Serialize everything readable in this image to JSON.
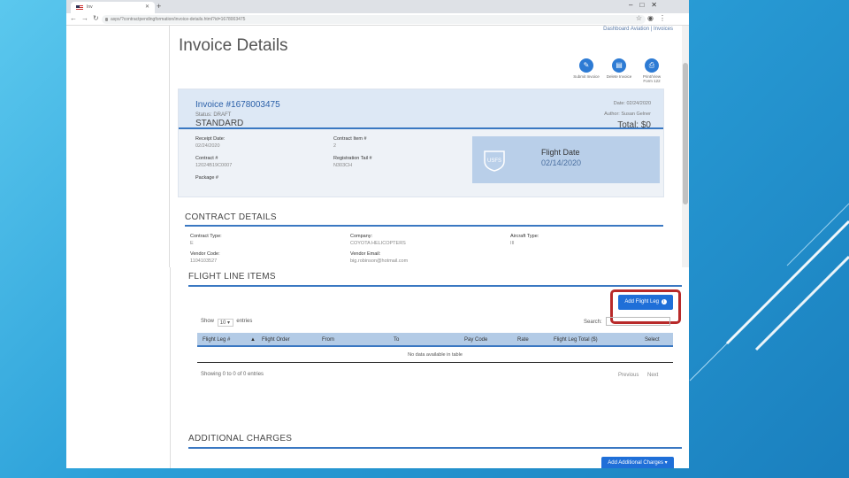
{
  "colors": {
    "accent": "#3a78c2",
    "button": "#1f6fd8",
    "highlight_box": "#b82a2a",
    "slide_bg": "#2a9fd8"
  },
  "browser": {
    "tab_title": "Inv",
    "address": "aspx/?contractpendingformation/invoice-details.html?id=1678003475",
    "icons": [
      "back-icon",
      "forward-icon",
      "reload-icon",
      "star-icon",
      "account-icon",
      "menu-icon"
    ]
  },
  "header": {
    "links": "Dashboard   Aviation   |   Invoices",
    "title": "Invoice Details",
    "actions": [
      {
        "label": "Submit Invoice",
        "icon": "edit-icon",
        "glyph": "✎"
      },
      {
        "label": "Delete Invoice",
        "icon": "document-icon",
        "glyph": "▤"
      },
      {
        "label": "Print/View Form 122",
        "icon": "print-icon",
        "glyph": "⎙"
      }
    ]
  },
  "invoice": {
    "number": "Invoice #1678003475",
    "status": "Status: DRAFT",
    "type": "STANDARD",
    "date": "Date: 02/24/2020",
    "author": "Author: Susan Gelner",
    "total": "Total: $0",
    "fields": {
      "receipt_date_label": "Receipt Date:",
      "receipt_date": "02/24/2020",
      "contract_item_label": "Contract Item #",
      "contract_item": "2",
      "contract_label": "Contract #",
      "contract": "12024B19C0007",
      "registration_label": "Registration Tail #",
      "registration": "N303CH",
      "package_label": "Package #"
    },
    "flight_date_label": "Flight Date",
    "flight_date": "02/14/2020",
    "logo_text": "USFS"
  },
  "contract": {
    "title": "CONTRACT DETAILS",
    "type_label": "Contract Type:",
    "type": "E",
    "company_label": "Company:",
    "company": "COYOTA HELICOPTERS",
    "aircraft_label": "Aircraft Type:",
    "aircraft": "III",
    "vendor_code_label": "Vendor Code:",
    "vendor_code": "1104103527",
    "vendor_email_label": "Vendor Email:",
    "vendor_email": "big.robinson@hotmail.com"
  },
  "flight_items": {
    "title": "FLIGHT LINE ITEMS",
    "add_button": "Add Flight Leg",
    "show_label": "Show",
    "show_value": "10",
    "entries_label": "entries",
    "search_label": "Search:",
    "columns": [
      "Flight Leg #",
      "Flight Order",
      "From",
      "To",
      "Pay Code",
      "Rate",
      "Flight Leg Total ($)",
      "Select"
    ],
    "empty_text": "No data available in table",
    "info": "Showing 0 to 0 of 0 entries",
    "previous": "Previous",
    "next": "Next"
  },
  "additional": {
    "title": "ADDITIONAL CHARGES",
    "add_button": "Add Additional Charges ▾"
  }
}
